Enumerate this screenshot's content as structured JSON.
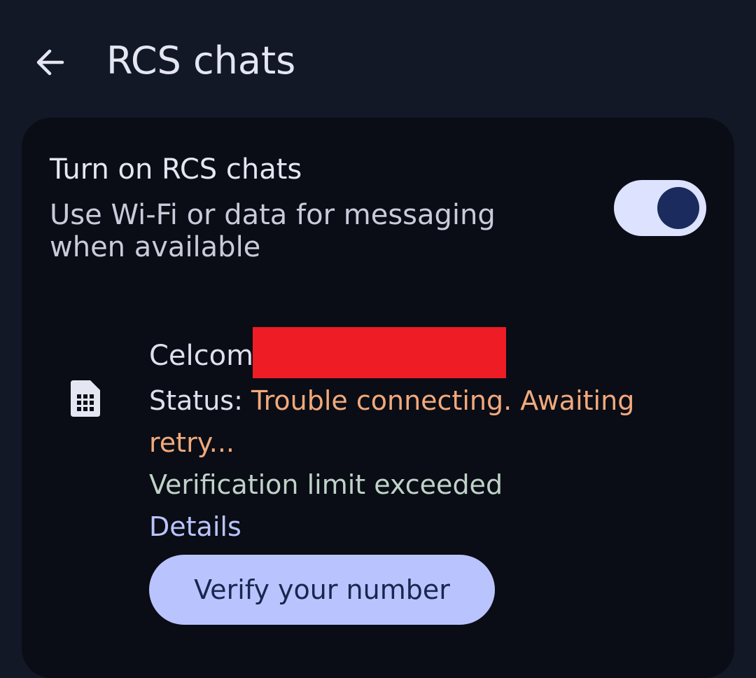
{
  "header": {
    "title": "RCS chats",
    "back_icon": "arrow-left-icon"
  },
  "rcs_setting": {
    "title": "Turn on RCS chats",
    "description": "Use Wi-Fi or data for messaging when available",
    "toggle_state": "on"
  },
  "sim": {
    "icon": "sim-card-icon",
    "carrier_name": "Celcom",
    "status_label": "Status: ",
    "status_value": "Trouble connecting. Awaiting retry...",
    "verification_message": "Verification limit exceeded",
    "details_label": "Details",
    "verify_button_label": "Verify your number"
  },
  "colors": {
    "background": "#131826",
    "card": "#0a0d15",
    "accent": "#b9c4ff",
    "status_warning": "#f2a97c",
    "redaction": "#ee1c24"
  }
}
